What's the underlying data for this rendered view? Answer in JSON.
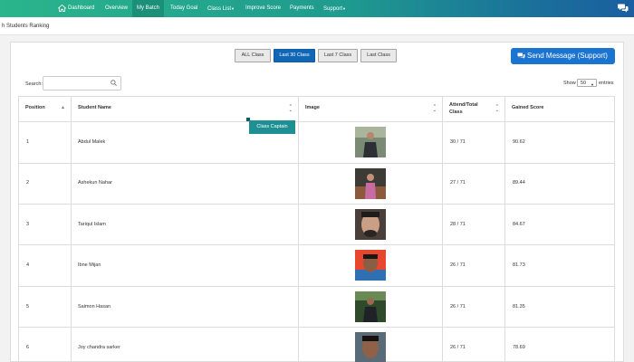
{
  "navbar": {
    "items": [
      {
        "label": "Dashboard",
        "active": false
      },
      {
        "label": "Overview",
        "active": false
      },
      {
        "label": "My Batch",
        "active": true
      },
      {
        "label": "Today Goal",
        "active": false
      },
      {
        "label": "Class List",
        "active": false,
        "dropdown": true
      },
      {
        "label": "Improve Score",
        "active": false
      },
      {
        "label": "Payments",
        "active": false
      },
      {
        "label": "Support",
        "active": false,
        "dropdown": true
      }
    ],
    "colors": {
      "start": "#2ab58c",
      "end": "#1a5fa0"
    },
    "icons": {
      "home": "home-icon",
      "chat": "chat-bubbles-icon"
    }
  },
  "page": {
    "title": "h Students Ranking"
  },
  "filters": [
    {
      "label": "ALL Class",
      "active": false
    },
    {
      "label": "Last 30 Class",
      "active": true
    },
    {
      "label": "Last 7 Class",
      "active": false
    },
    {
      "label": "Last Class",
      "active": false
    }
  ],
  "send_message": {
    "label": "Send Message (Support)",
    "icon": "message-icon",
    "color": "#1a74d0"
  },
  "search": {
    "label": "Search:",
    "value": "",
    "placeholder": ""
  },
  "length": {
    "show_label": "Show",
    "value": "50",
    "entries_label": "entries"
  },
  "table": {
    "columns": [
      "Position",
      "Student Name",
      "Image",
      "Attend/Total Class",
      "Gained Score"
    ],
    "badge": "Class Captain",
    "rows": [
      {
        "position": "1",
        "name": "Abdul Malek",
        "attend": "30 / 71",
        "score": "90.62"
      },
      {
        "position": "2",
        "name": "Ashekun Nahar",
        "attend": "27 / 71",
        "score": "89.44"
      },
      {
        "position": "3",
        "name": "Tariqul Islam",
        "attend": "28 / 71",
        "score": "84.67"
      },
      {
        "position": "4",
        "name": "Ibne Mijan",
        "attend": "26 / 71",
        "score": "81.73"
      },
      {
        "position": "5",
        "name": "Saimon Hasan",
        "attend": "26 / 71",
        "score": "81.35"
      },
      {
        "position": "6",
        "name": "Joy chandra sarker",
        "attend": "26 / 71",
        "score": "78.69"
      }
    ]
  }
}
